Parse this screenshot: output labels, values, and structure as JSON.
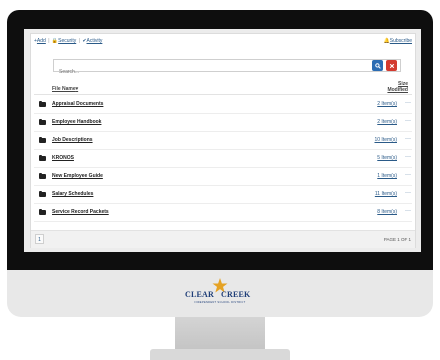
{
  "toolbar": {
    "add_label": "Add",
    "security_label": "Security",
    "activity_label": "Activity",
    "subscribe_label": "Subscribe"
  },
  "search": {
    "placeholder": "Search..."
  },
  "table": {
    "name_header": "File Name",
    "size_header": "Size",
    "modified_header": "Modified",
    "rows": [
      {
        "name": "Appraisal Documents",
        "count": "2 Item(s)",
        "more": "···"
      },
      {
        "name": "Employee Handbook",
        "count": "2 Item(s)",
        "more": "···"
      },
      {
        "name": "Job Descriptions",
        "count": "10 Item(s)",
        "more": "···"
      },
      {
        "name": "KRONOS",
        "count": "5 Item(s)",
        "more": "···"
      },
      {
        "name": "New Employee Guide",
        "count": "1 Item(s)",
        "more": "···"
      },
      {
        "name": "Salary Schedules",
        "count": "11 Item(s)",
        "more": "···"
      },
      {
        "name": "Service Record Packets",
        "count": "8 Item(s)",
        "more": "···"
      }
    ]
  },
  "pagination": {
    "current": "1",
    "text": "PAGE 1 OF 1"
  },
  "logo": {
    "word1": "CLEAR",
    "word2": "CREEK",
    "subtitle": "INDEPENDENT SCHOOL DISTRICT"
  },
  "colors": {
    "link": "#2a5a88",
    "search_button": "#2b6cb3",
    "clear_button": "#d33a2f",
    "logo_blue": "#1f3e78",
    "logo_star": "#e5a224"
  },
  "icons": {
    "add": "plus-icon",
    "security": "lock-icon",
    "activity": "check-icon",
    "subscribe": "bell-icon",
    "search": "magnifier-icon",
    "clear": "x-icon",
    "folder": "folder-icon",
    "sort": "sort-arrow-icon"
  }
}
